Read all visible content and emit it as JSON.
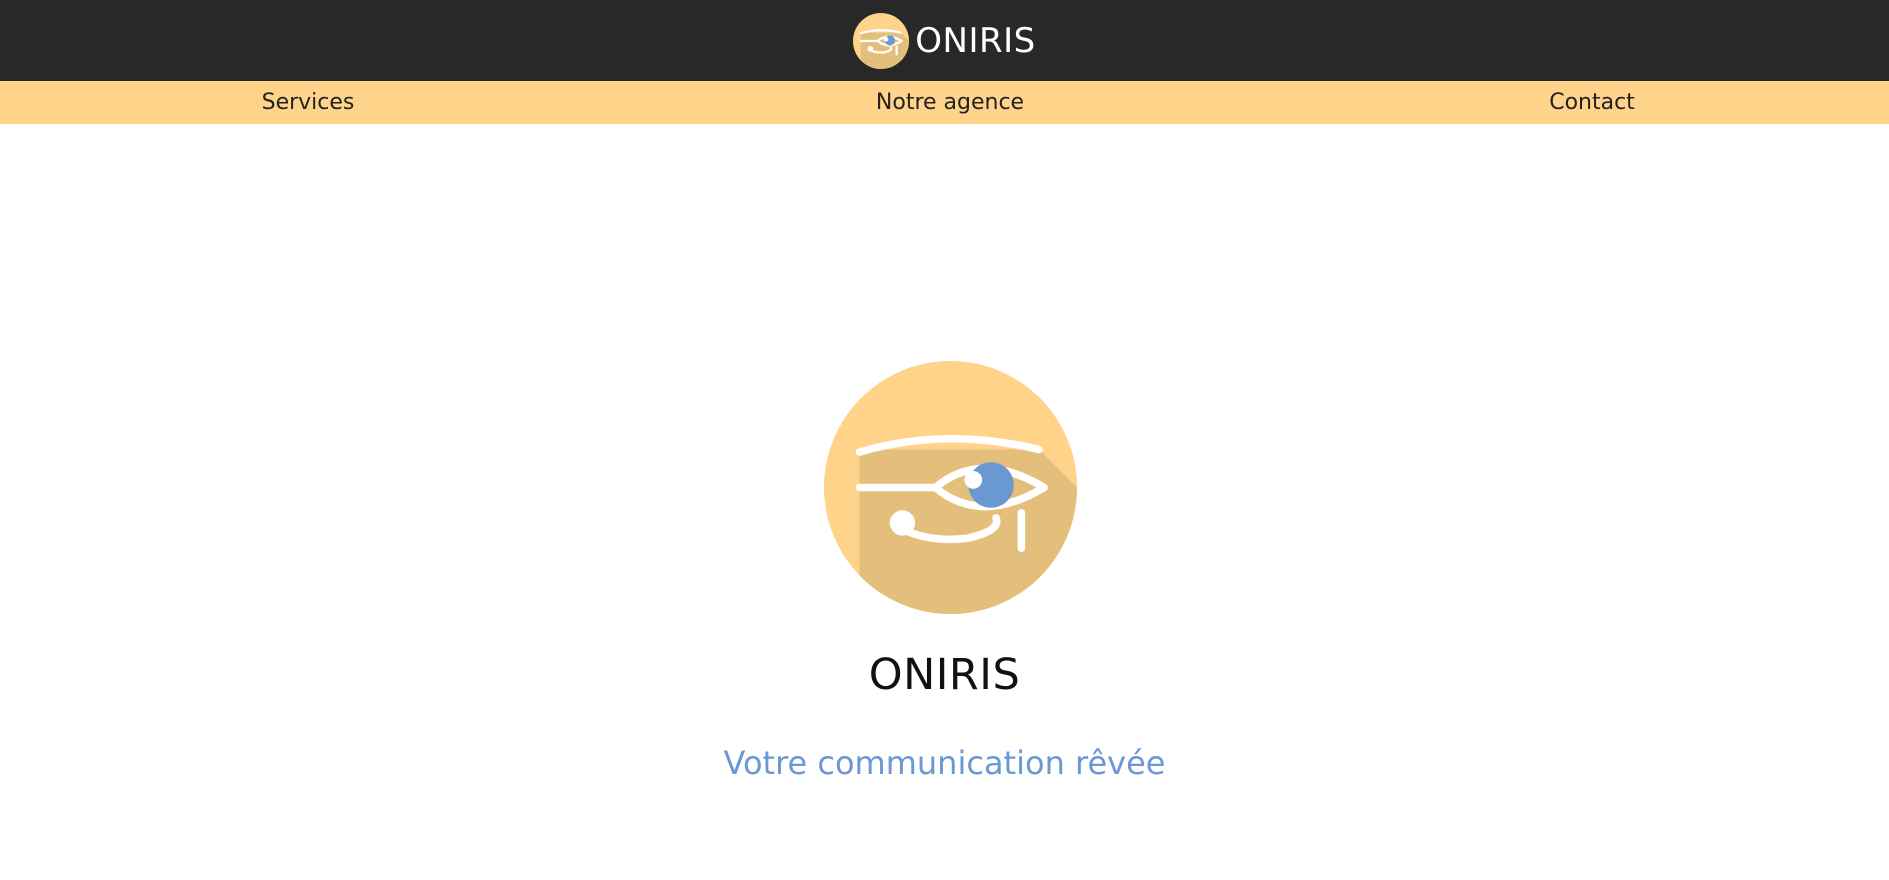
{
  "header": {
    "brand_name": "ONIRIS",
    "logo_icon": "eye-of-horus-icon"
  },
  "nav": {
    "items": [
      {
        "label": "Services"
      },
      {
        "label": "Notre agence"
      },
      {
        "label": "Contact"
      }
    ]
  },
  "hero": {
    "title": "ONIRIS",
    "tagline": "Votre communication rêvée",
    "logo_icon": "eye-of-horus-icon"
  },
  "colors": {
    "header_bg": "#282828",
    "nav_bg": "#ffd38a",
    "logo_circle": "#ffd38a",
    "logo_shadow": "#e4bf7c",
    "iris": "#6a98d2",
    "tagline": "#6a98d2"
  }
}
